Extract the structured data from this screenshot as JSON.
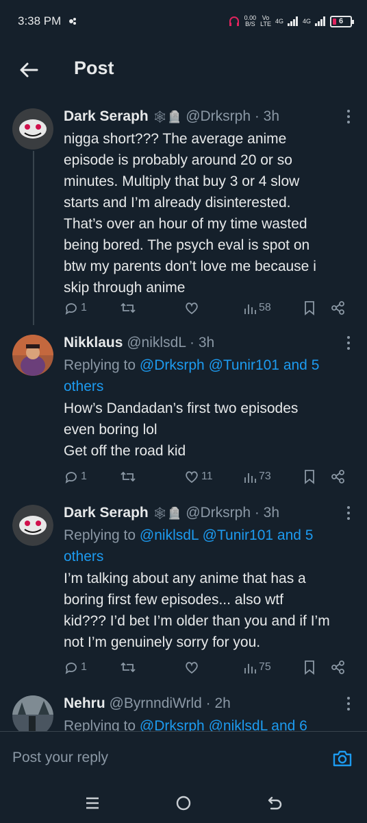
{
  "status_bar": {
    "time": "3:38 PM",
    "net_speed_value": "0.00",
    "net_speed_unit": "B/S",
    "volte_top": "Vo",
    "volte_bottom": "LTE",
    "signal1_label": "4G",
    "signal2_label": "4G",
    "battery_level": "6"
  },
  "header": {
    "title": "Post"
  },
  "posts": [
    {
      "name": "Dark Seraph",
      "handle": "@Drksrph",
      "time": " · 3h",
      "replying_prefix": "",
      "mentions": "",
      "text_lines": [
        "nigga short??? The average anime",
        "episode is probably around 20 or so",
        "minutes. Multiply that buy 3 or 4 slow",
        "starts and I’m already disinterested.",
        "That’s over an hour of my time wasted",
        "being bored. The psych eval is spot on",
        "btw my parents don’t love me because i",
        "skip through anime"
      ],
      "replies": "1",
      "retweets": "",
      "likes": "",
      "views": "58"
    },
    {
      "name": "Nikklaus",
      "handle": "@niklsdL",
      "time": " · 3h",
      "replying_prefix": "Replying to ",
      "mentions_line1": "@Drksrph @Tunir101 and 5",
      "mentions_line2": "others",
      "text_lines": [
        "How’s Dandadan’s first two episodes",
        "even boring lol",
        "Get off the road kid"
      ],
      "replies": "1",
      "retweets": "",
      "likes": "11",
      "views": "73"
    },
    {
      "name": "Dark Seraph",
      "handle": "@Drksrph",
      "time": " · 3h",
      "replying_prefix": "Replying to ",
      "mentions_line1": "@niklsdL @Tunir101 and 5",
      "mentions_line2": "others",
      "text_lines": [
        "I’m talking about any anime that has a",
        "boring first few episodes... also wtf",
        "kid??? I’d bet I’m older than you and if I’m",
        "not I’m genuinely sorry for you."
      ],
      "replies": "1",
      "retweets": "",
      "likes": "",
      "views": "75"
    },
    {
      "name": "Nehru",
      "handle": "@ByrnndiWrld",
      "time": " · 2h",
      "replying_prefix": "Replying to ",
      "mentions_line1": "@Drksrph @niklsdL and 6"
    }
  ],
  "reply_bar": {
    "placeholder": "Post your reply"
  },
  "icons": {
    "accent": "#1d9bf0",
    "muted": "#8b98a5",
    "background": "#15202b"
  }
}
